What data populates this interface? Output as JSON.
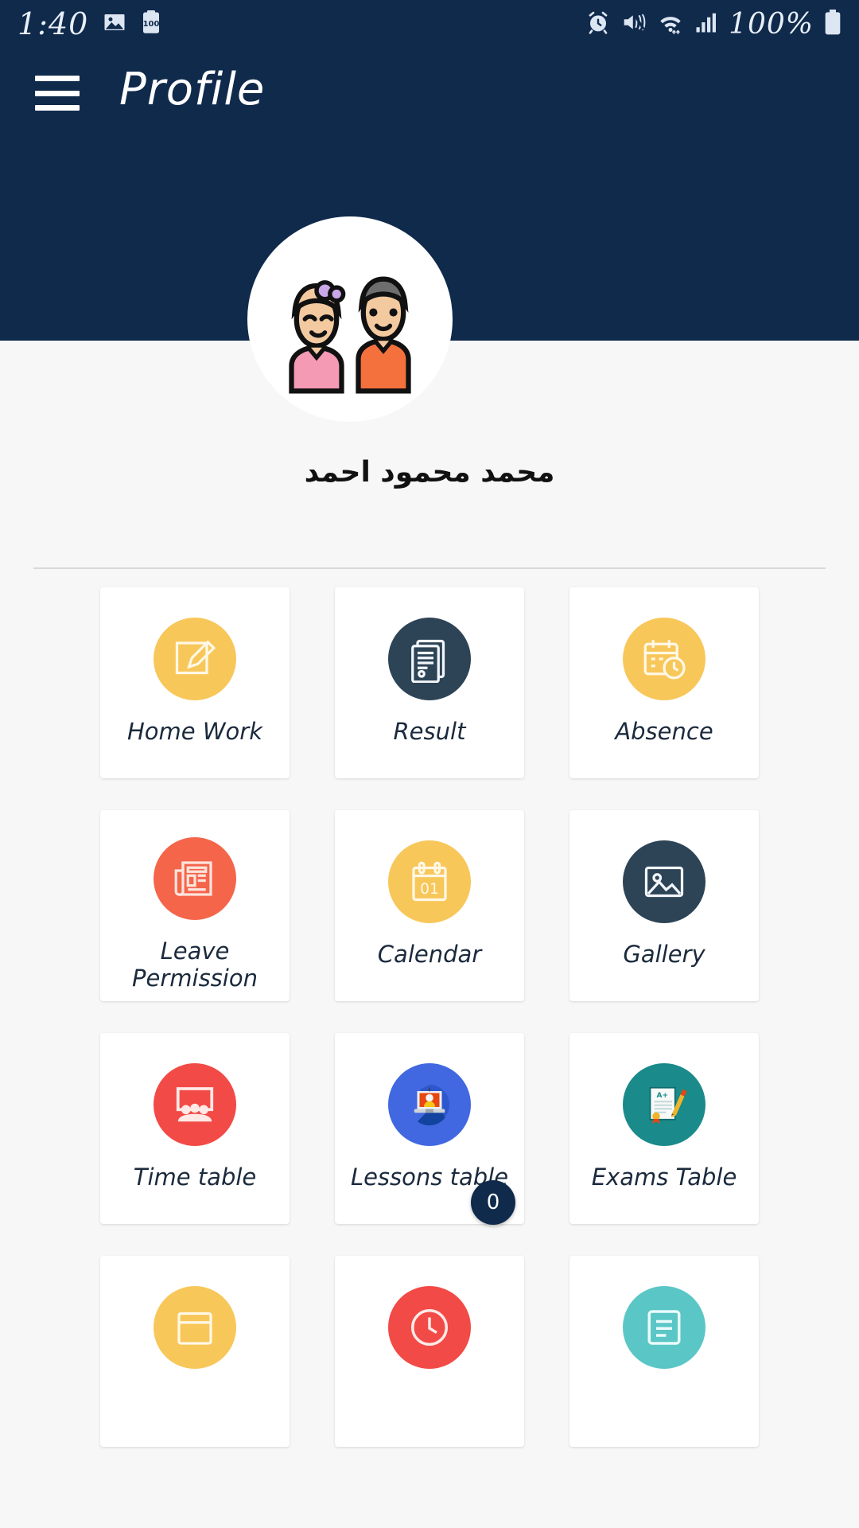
{
  "statusbar": {
    "time": "1:40",
    "battery_percent": "100%",
    "left_icons": [
      "image-icon",
      "clipboard-100-icon"
    ],
    "right_icons": [
      "alarm-icon",
      "mute-icon",
      "wifi-icon",
      "signal-icon",
      "battery-icon"
    ]
  },
  "appbar": {
    "title": "Profile",
    "menu_icon": "hamburger-icon",
    "background_color": "#102A4C"
  },
  "profile": {
    "name": "محمد محمود احمد",
    "avatar_icon": "two-children-avatar"
  },
  "grid": {
    "items": [
      {
        "label": "Home Work",
        "icon": "pencil-square-icon",
        "circle_color": "#F8C75A",
        "icon_style": "outline"
      },
      {
        "label": "Result",
        "icon": "document-report-icon",
        "circle_color": "#2D4356",
        "icon_style": "outline"
      },
      {
        "label": "Absence",
        "icon": "calendar-clock-icon",
        "circle_color": "#F8C75A",
        "icon_style": "outline"
      },
      {
        "label": "Leave\nPermission",
        "icon": "newspaper-icon",
        "circle_color": "#F4654A",
        "icon_style": "outline"
      },
      {
        "label": "Calendar",
        "icon": "calendar-01-icon",
        "circle_color": "#F8C75A",
        "icon_style": "outline"
      },
      {
        "label": "Gallery",
        "icon": "photo-frame-icon",
        "circle_color": "#2D4356",
        "icon_style": "outline"
      },
      {
        "label": "Time table",
        "icon": "classroom-board-icon",
        "circle_color": "#F24A46",
        "icon_style": "outline"
      },
      {
        "label": "Lessons table",
        "icon": "laptop-lesson-icon",
        "circle_color": "#4168E0",
        "icon_style": "flat"
      },
      {
        "label": "Exams Table",
        "icon": "exam-paper-icon",
        "circle_color": "#1A8A8A",
        "icon_style": "flat"
      },
      {
        "label": "",
        "icon": "partial-yellow-icon",
        "circle_color": "#F8C75A",
        "icon_style": "outline"
      },
      {
        "label": "",
        "icon": "partial-red-icon",
        "circle_color": "#F24A46",
        "icon_style": "outline"
      },
      {
        "label": "",
        "icon": "partial-teal-icon",
        "circle_color": "#5BC6C6",
        "icon_style": "outline"
      }
    ]
  },
  "badge": {
    "count": "0"
  }
}
